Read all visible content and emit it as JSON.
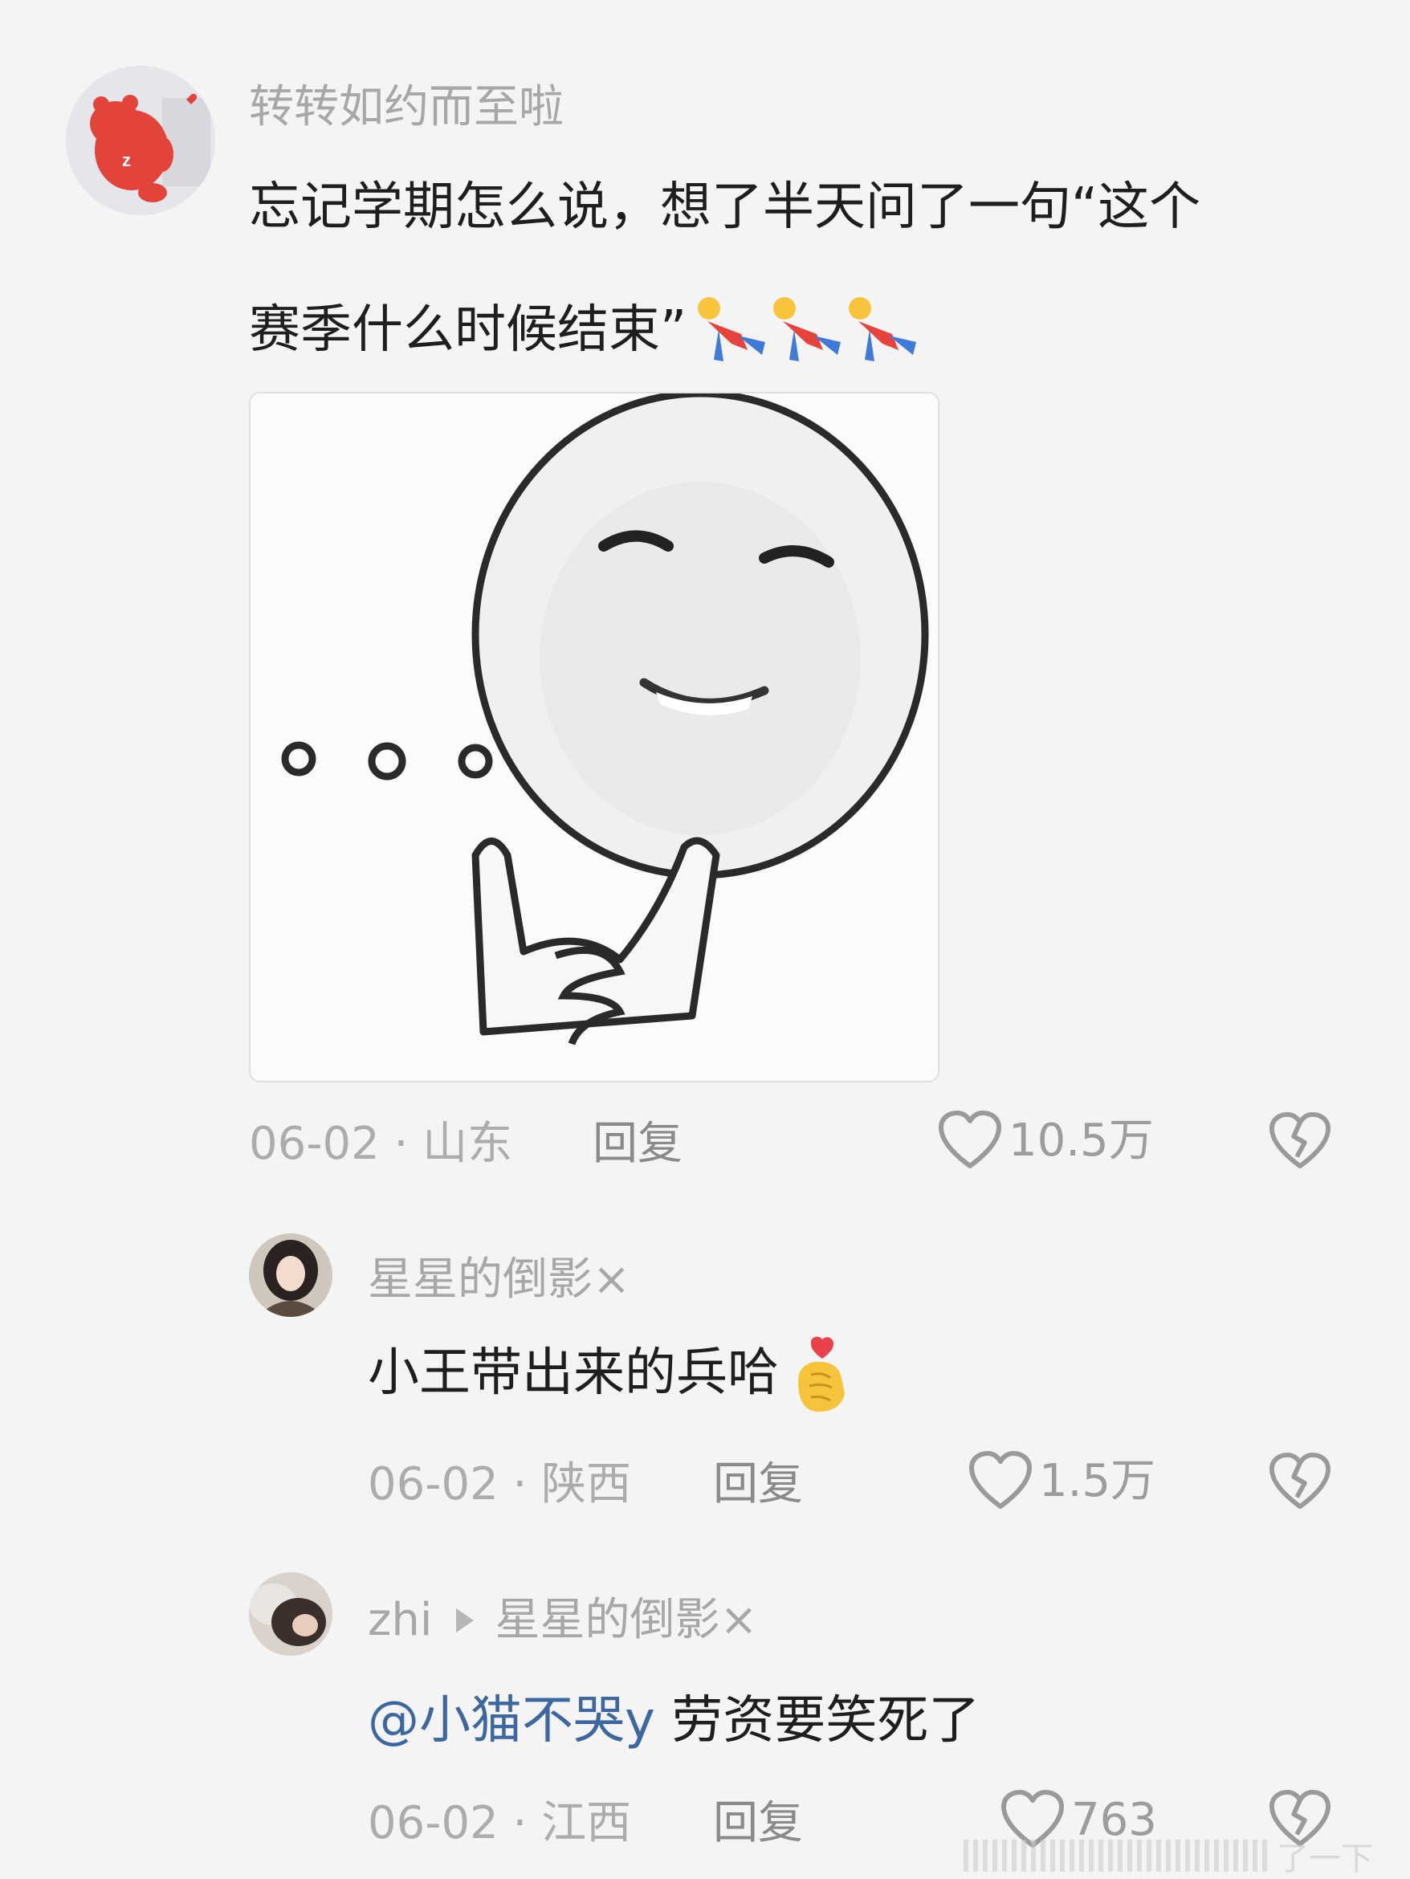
{
  "comments": [
    {
      "user": "转转如约而至啦",
      "text_line1": "忘记学期怎么说，想了半天问了一句“这个",
      "text_line2": "赛季什么时候结束”",
      "date_loc": "06-02 · 山东",
      "reply_label": "回复",
      "likes": "10.5万"
    },
    {
      "user": "星星的倒影×",
      "text": "小王带出来的兵哈",
      "date_loc": "06-02 · 陕西",
      "reply_label": "回复",
      "likes": "1.5万"
    },
    {
      "user": "zhi",
      "reply_to": "星星的倒影×",
      "mention": "@小猫不哭y",
      "text": " 劳资要笑死了",
      "date_loc": "06-02 · 江西",
      "reply_label": "回复",
      "likes": "763"
    }
  ],
  "watermark": "了一下",
  "colors": {
    "mention": "#3c67a0",
    "meta": "#acacac",
    "username": "#a7a7a7"
  }
}
